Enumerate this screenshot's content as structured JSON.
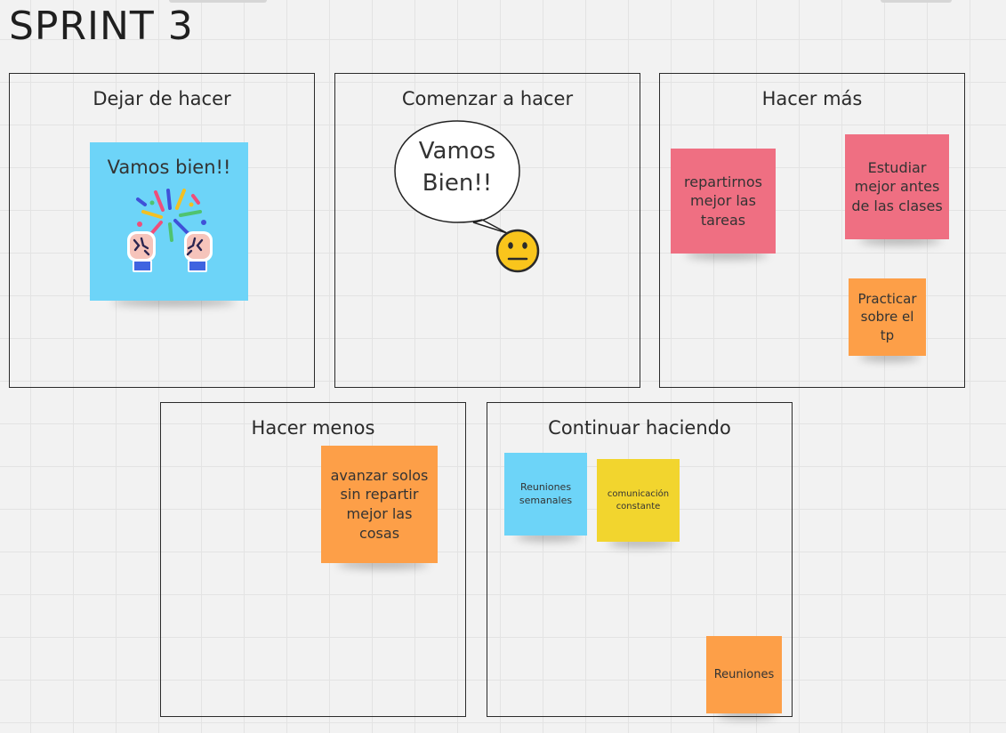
{
  "board": {
    "title": "SPRINT 3"
  },
  "frames": {
    "stop": {
      "title": "Dejar de hacer"
    },
    "start": {
      "title": "Comenzar a hacer"
    },
    "more": {
      "title": "Hacer más"
    },
    "less": {
      "title": "Hacer menos"
    },
    "keep": {
      "title": "Continuar haciendo"
    }
  },
  "notes": {
    "vamos_bien": "Vamos bien!!",
    "speech_line1": "Vamos",
    "speech_line2": "Bien!!",
    "repartirnos": "repartirnos mejor las tareas",
    "estudiar": "Estudiar mejor antes de las clases",
    "practicar": "Practicar sobre el tp",
    "avanzar": "avanzar solos sin repartir mejor las cosas",
    "reuniones_semanales": "Reuniones semanales",
    "comunicacion": "comunicación constante",
    "reuniones": "Reuniones"
  },
  "colors": {
    "sticky_blue": "#6dd4f8",
    "sticky_pink": "#ef6f82",
    "sticky_orange": "#fd9f48",
    "sticky_yellow": "#f2d52e",
    "emoji_yellow": "#f9c51c"
  },
  "icons": {
    "celebration": "celebration-hands-icon",
    "neutral_face": "neutral-face-icon"
  }
}
